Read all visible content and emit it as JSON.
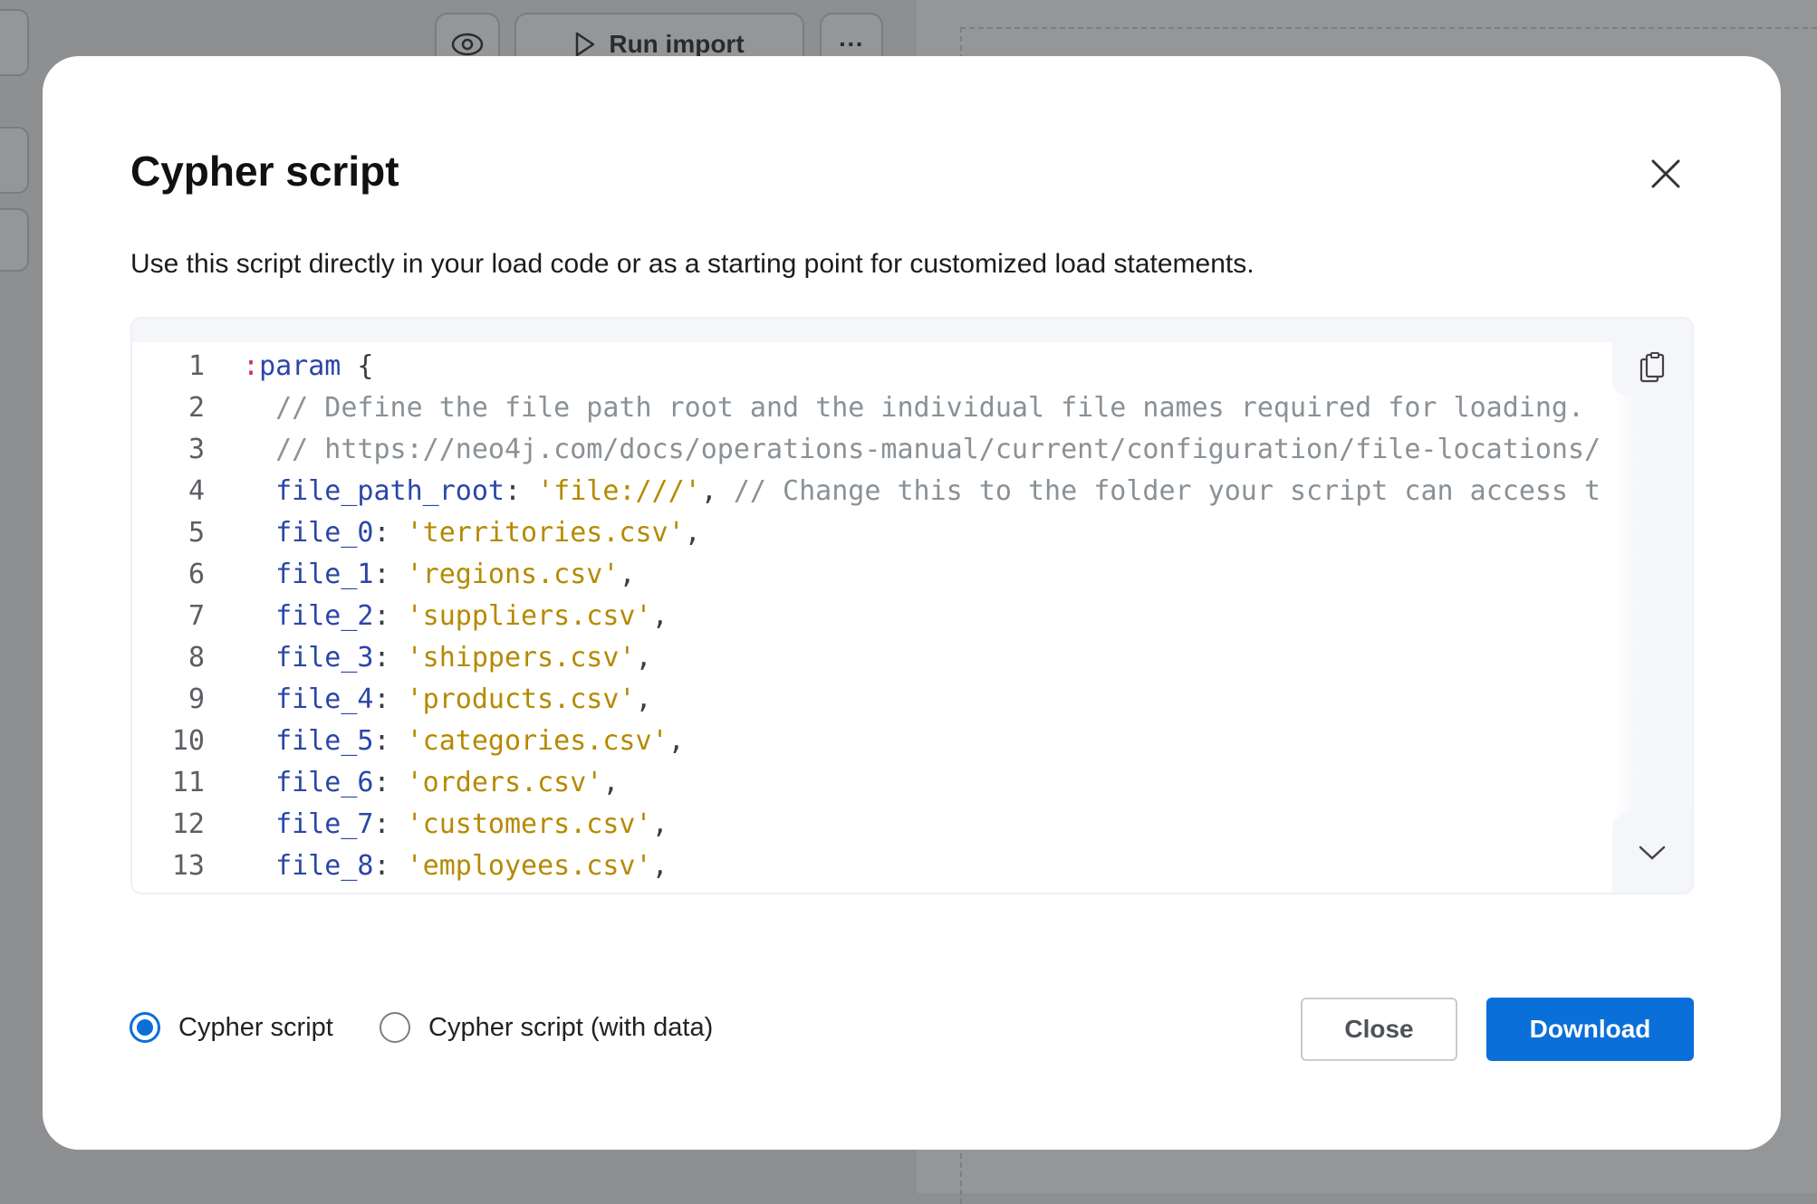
{
  "background": {
    "run_import_label": "Run import",
    "more_label": "···"
  },
  "modal": {
    "title": "Cypher script",
    "description": "Use this script directly in your load code or as a starting point for customized load statements.",
    "code_lines": [
      {
        "n": "1",
        "parts": [
          {
            "t": ":",
            "c": "kw"
          },
          {
            "t": "param",
            "c": "id"
          },
          {
            "t": " {",
            "c": "pn"
          }
        ]
      },
      {
        "n": "2",
        "parts": [
          {
            "t": "  // Define the file path root and the individual file names required for loading.",
            "c": "cm"
          }
        ]
      },
      {
        "n": "3",
        "parts": [
          {
            "t": "  // https://neo4j.com/docs/operations-manual/current/configuration/file-locations/",
            "c": "cm"
          }
        ]
      },
      {
        "n": "4",
        "parts": [
          {
            "t": "  file_path_root",
            "c": "id"
          },
          {
            "t": ": ",
            "c": "pn"
          },
          {
            "t": "'file:///'",
            "c": "str"
          },
          {
            "t": ", ",
            "c": "pn"
          },
          {
            "t": "// Change this to the folder your script can access t",
            "c": "cm"
          }
        ]
      },
      {
        "n": "5",
        "parts": [
          {
            "t": "  file_0",
            "c": "id"
          },
          {
            "t": ": ",
            "c": "pn"
          },
          {
            "t": "'territories.csv'",
            "c": "str"
          },
          {
            "t": ",",
            "c": "pn"
          }
        ]
      },
      {
        "n": "6",
        "parts": [
          {
            "t": "  file_1",
            "c": "id"
          },
          {
            "t": ": ",
            "c": "pn"
          },
          {
            "t": "'regions.csv'",
            "c": "str"
          },
          {
            "t": ",",
            "c": "pn"
          }
        ]
      },
      {
        "n": "7",
        "parts": [
          {
            "t": "  file_2",
            "c": "id"
          },
          {
            "t": ": ",
            "c": "pn"
          },
          {
            "t": "'suppliers.csv'",
            "c": "str"
          },
          {
            "t": ",",
            "c": "pn"
          }
        ]
      },
      {
        "n": "8",
        "parts": [
          {
            "t": "  file_3",
            "c": "id"
          },
          {
            "t": ": ",
            "c": "pn"
          },
          {
            "t": "'shippers.csv'",
            "c": "str"
          },
          {
            "t": ",",
            "c": "pn"
          }
        ]
      },
      {
        "n": "9",
        "parts": [
          {
            "t": "  file_4",
            "c": "id"
          },
          {
            "t": ": ",
            "c": "pn"
          },
          {
            "t": "'products.csv'",
            "c": "str"
          },
          {
            "t": ",",
            "c": "pn"
          }
        ]
      },
      {
        "n": "10",
        "parts": [
          {
            "t": "  file_5",
            "c": "id"
          },
          {
            "t": ": ",
            "c": "pn"
          },
          {
            "t": "'categories.csv'",
            "c": "str"
          },
          {
            "t": ",",
            "c": "pn"
          }
        ]
      },
      {
        "n": "11",
        "parts": [
          {
            "t": "  file_6",
            "c": "id"
          },
          {
            "t": ": ",
            "c": "pn"
          },
          {
            "t": "'orders.csv'",
            "c": "str"
          },
          {
            "t": ",",
            "c": "pn"
          }
        ]
      },
      {
        "n": "12",
        "parts": [
          {
            "t": "  file_7",
            "c": "id"
          },
          {
            "t": ": ",
            "c": "pn"
          },
          {
            "t": "'customers.csv'",
            "c": "str"
          },
          {
            "t": ",",
            "c": "pn"
          }
        ]
      },
      {
        "n": "13",
        "parts": [
          {
            "t": "  file_8",
            "c": "id"
          },
          {
            "t": ": ",
            "c": "pn"
          },
          {
            "t": "'employees.csv'",
            "c": "str"
          },
          {
            "t": ",",
            "c": "pn"
          }
        ]
      }
    ],
    "options": [
      {
        "label": "Cypher script",
        "selected": true
      },
      {
        "label": "Cypher script (with data)",
        "selected": false
      }
    ],
    "close_label": "Close",
    "download_label": "Download",
    "accent_color": "#0a6fd8"
  }
}
